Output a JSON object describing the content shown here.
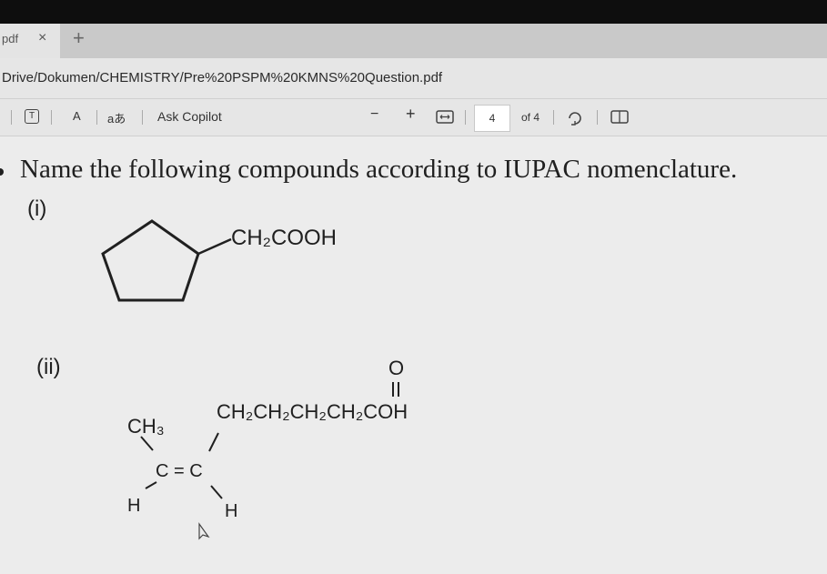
{
  "tab": {
    "title": "pdf",
    "close": "×",
    "new_tab": "+"
  },
  "address": {
    "url": "Drive/Dokumen/CHEMISTRY/Pre%20PSPM%20KMNS%20Question.pdf"
  },
  "toolbar": {
    "text_icon": "T",
    "read_aloud": "A",
    "translate": "aあ",
    "ask_copilot": "Ask Copilot",
    "zoom_out": "−",
    "zoom_in": "+",
    "page_current": "4",
    "page_total": "of 4"
  },
  "document": {
    "question": "Name the following compounds according to IUPAC nomenclature.",
    "part_i": {
      "label": "(i)",
      "substituent": "CH₂COOH"
    },
    "part_ii": {
      "label": "(ii)",
      "ch3": "CH₃",
      "chain": "CH₂CH₂CH₂CH₂COH",
      "oxygen": "O",
      "double_bond": "C = C",
      "h_left": "H",
      "h_right": "H"
    }
  }
}
